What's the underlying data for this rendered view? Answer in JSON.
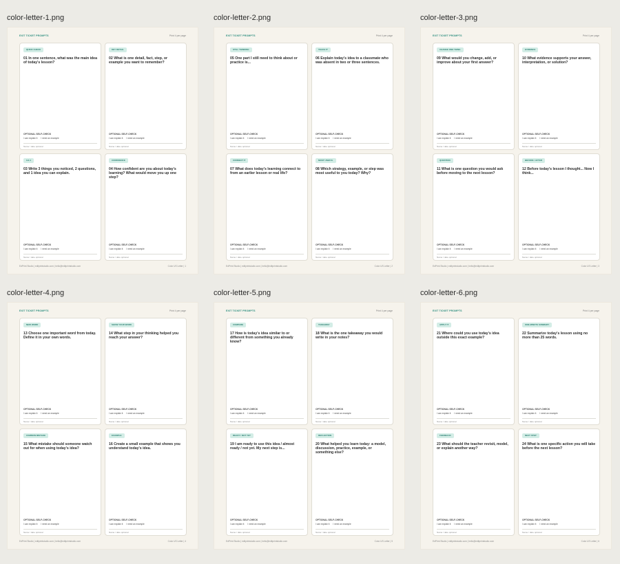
{
  "common": {
    "header_title": "EXIT TICKET PROMPTS",
    "header_right": "Print 4 per page",
    "self_check_label": "OPTIONAL SELF-CHECK",
    "self_check_options": [
      "I can explain it",
      "I need an example"
    ],
    "name_line": "Name / date optional",
    "footer_left": "EdPrint Studio | editprintstudio.com | hello@editprintstudio.com"
  },
  "pages": [
    {
      "file": "color-letter-1.png",
      "footer_right": "Color US Letter | 1",
      "cards": [
        {
          "tag": "QUICK CHECK",
          "prompt": "01 In one sentence, what was the main idea of today's lesson?"
        },
        {
          "tag": "KEY DETAIL",
          "prompt": "02 What is one detail, fact, step, or example you want to remember?"
        },
        {
          "tag": "3-2-1",
          "prompt": "03 Write 3 things you noticed, 2 questions, and 1 idea you can explain."
        },
        {
          "tag": "CONFIDENCE",
          "prompt": "04 How confident are you about today's learning? What would move you up one step?"
        }
      ]
    },
    {
      "file": "color-letter-2.png",
      "footer_right": "Color US Letter | 2",
      "cards": [
        {
          "tag": "STILL THINKING",
          "prompt": "05 One part I still need to think about or practice is..."
        },
        {
          "tag": "TEACH IT",
          "prompt": "06 Explain today's idea to a classmate who was absent in two or three sentences."
        },
        {
          "tag": "CONNECT IT",
          "prompt": "07 What does today's learning connect to from an earlier lesson or real life?"
        },
        {
          "tag": "MOST USEFUL",
          "prompt": "08 Which strategy, example, or step was most useful to you today? Why?"
        }
      ]
    },
    {
      "file": "color-letter-3.png",
      "footer_right": "Color US Letter | 3",
      "cards": [
        {
          "tag": "CHANGE ONE THING",
          "prompt": "09 What would you change, add, or improve about your first answer?"
        },
        {
          "tag": "EVIDENCE",
          "prompt": "10 What evidence supports your answer, interpretation, or solution?"
        },
        {
          "tag": "QUESTION",
          "prompt": "11 What is one question you would ask before moving to the next lesson?"
        },
        {
          "tag": "BEFORE / AFTER",
          "prompt": "12 Before today's lesson I thought... Now I think..."
        }
      ]
    },
    {
      "file": "color-letter-4.png",
      "footer_right": "Color US Letter | 4",
      "cards": [
        {
          "tag": "NEW WORD",
          "prompt": "13 Choose one important word from today. Define it in your own words."
        },
        {
          "tag": "SHOW YOUR WORK",
          "prompt": "14 What step in your thinking helped you reach your answer?"
        },
        {
          "tag": "COMMON MISTAKE",
          "prompt": "15 What mistake should someone watch out for when using today's idea?"
        },
        {
          "tag": "EXAMPLE",
          "prompt": "16 Create a small example that shows you understand today's idea."
        }
      ]
    },
    {
      "file": "color-letter-5.png",
      "footer_right": "Color US Letter | 5",
      "cards": [
        {
          "tag": "COMPARE",
          "prompt": "17 How is today's idea similar to or different from something you already know?"
        },
        {
          "tag": "TAKEAWAY",
          "prompt": "18 What is the one takeaway you would write in your notes?"
        },
        {
          "tag": "READY / NOT YET",
          "prompt": "19 I am ready to use this idea / almost ready / not yet. My next step is..."
        },
        {
          "tag": "REFLECTION",
          "prompt": "20 What helped you learn today: a model, discussion, practice, example, or something else?"
        }
      ]
    },
    {
      "file": "color-letter-6.png",
      "footer_right": "Color US Letter | 6",
      "cards": [
        {
          "tag": "APPLY IT",
          "prompt": "21 Where could you use today's idea outside this exact example?"
        },
        {
          "tag": "ONE-MINUTE SUMMARY",
          "prompt": "22 Summarize today's lesson using no more than 25 words."
        },
        {
          "tag": "FEEDBACK",
          "prompt": "23 What should the teacher revisit, model, or explain another way?"
        },
        {
          "tag": "NEXT STEP",
          "prompt": "24 What is one specific action you will take before the next lesson?"
        }
      ]
    }
  ]
}
